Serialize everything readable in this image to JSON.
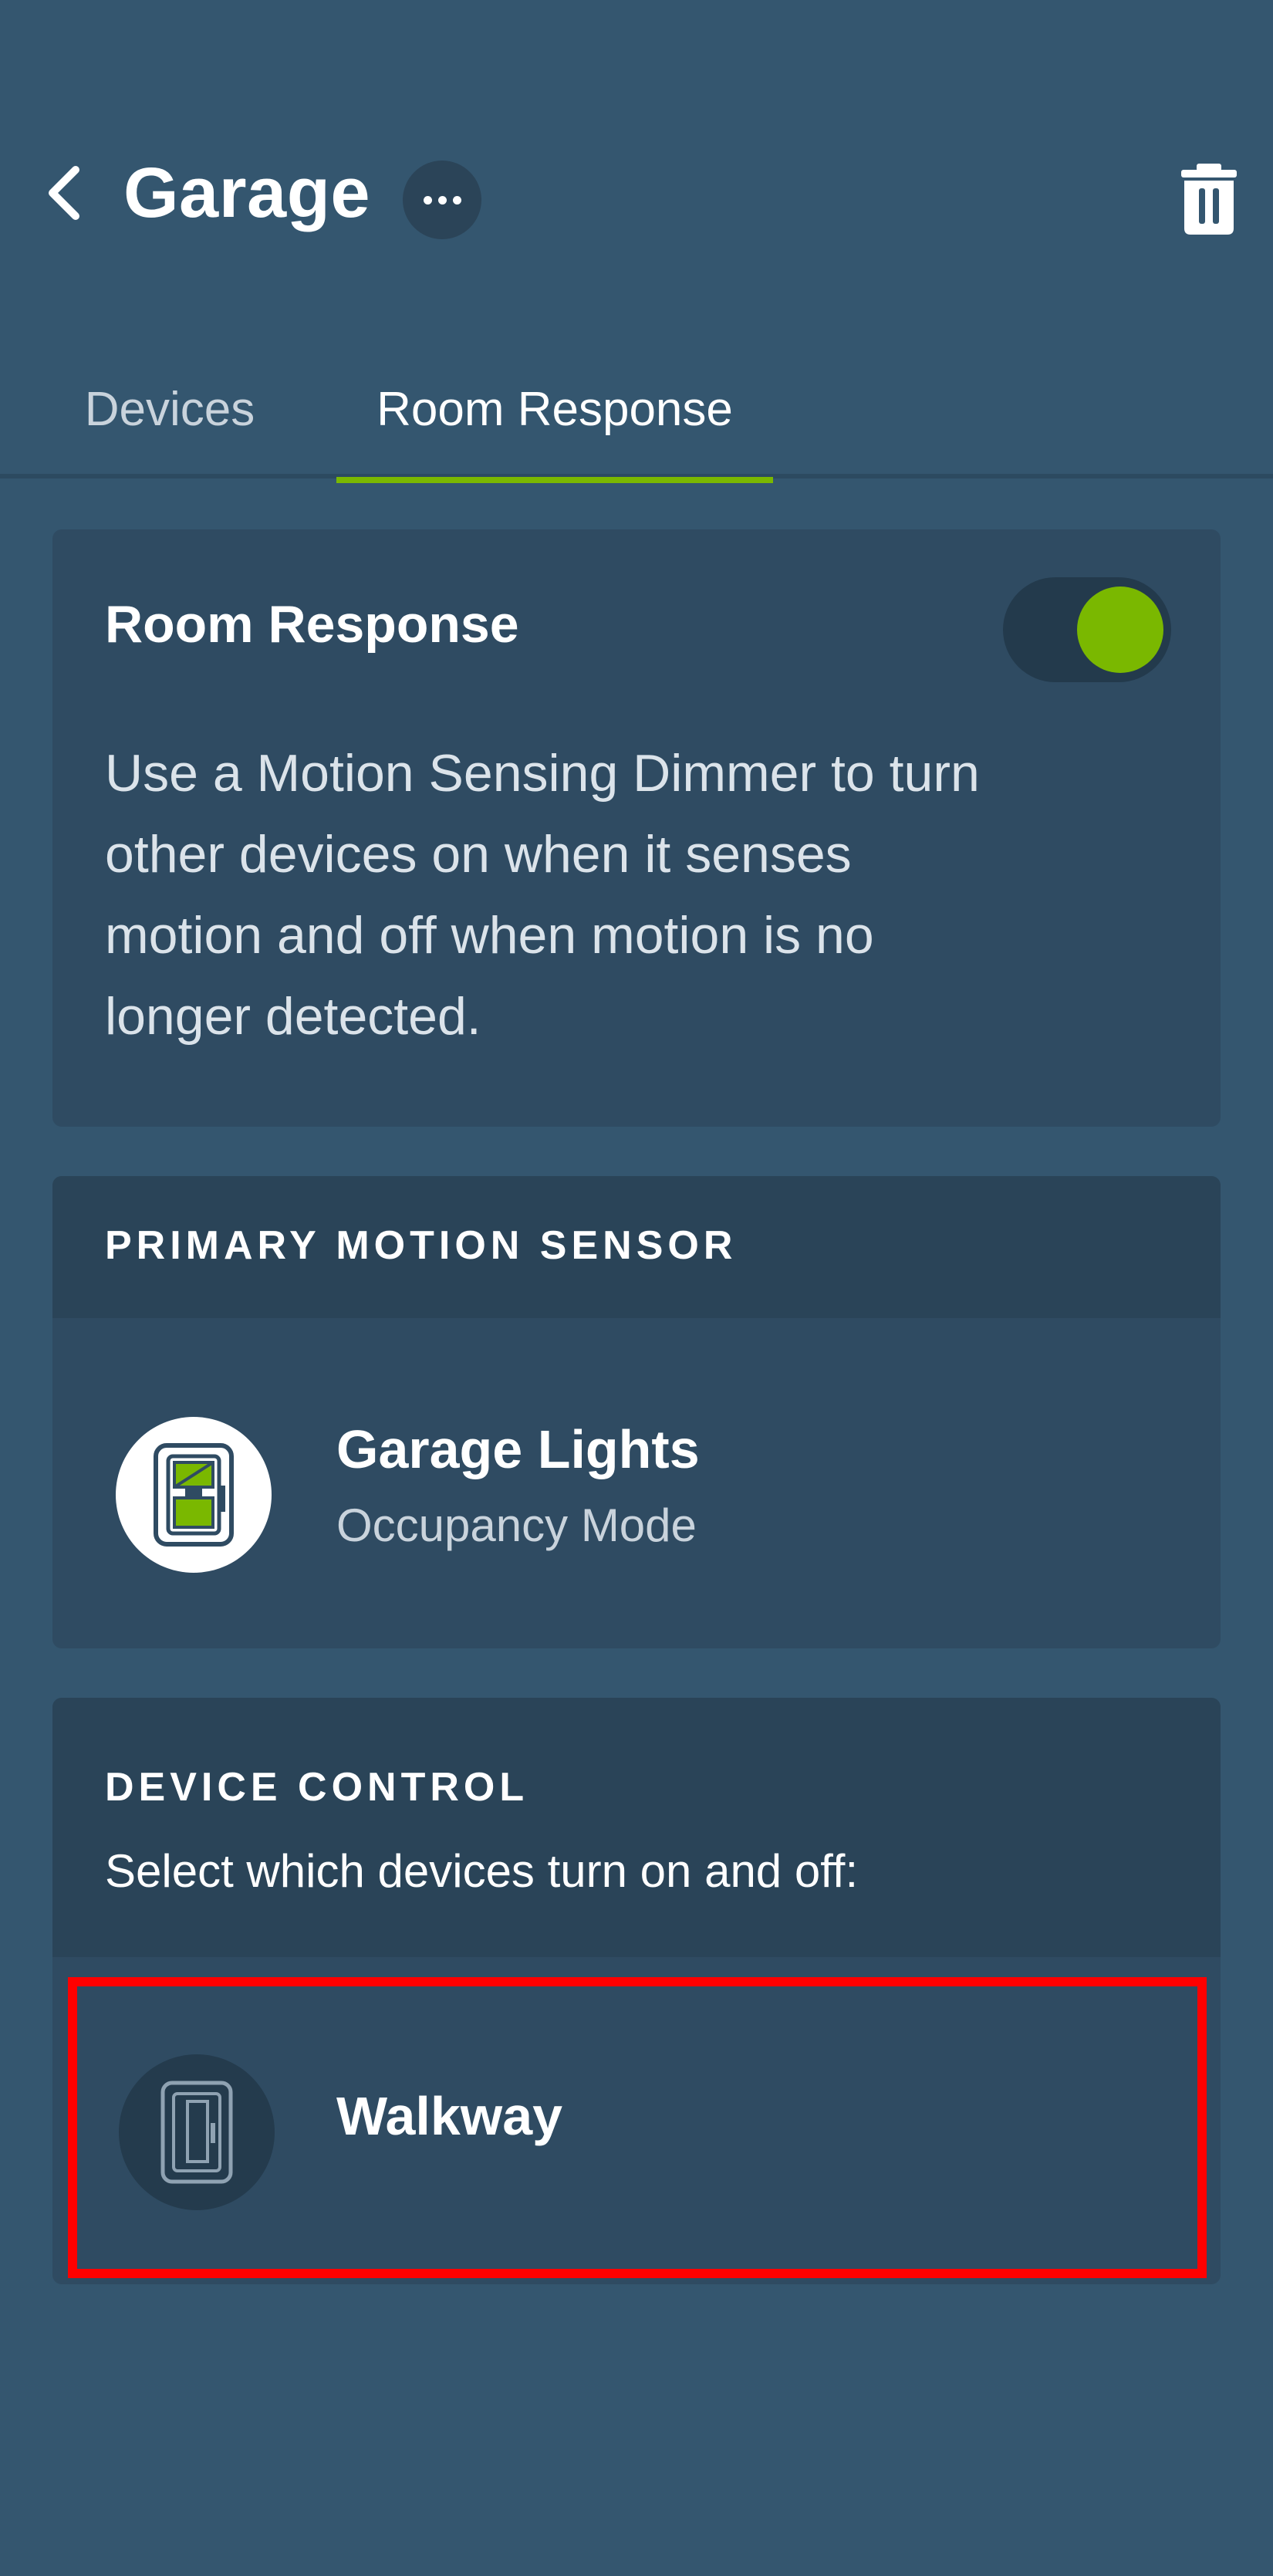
{
  "header": {
    "title": "Garage",
    "back_icon": "chevron-left-icon",
    "more_icon": "ellipsis-icon",
    "delete_icon": "trash-icon"
  },
  "tabs": [
    {
      "label": "Devices",
      "active": false
    },
    {
      "label": "Room Response",
      "active": true
    }
  ],
  "room_response": {
    "title": "Room Response",
    "enabled": true,
    "description": "Use a Motion Sensing Dimmer to turn other devices on when it senses motion and off when motion is no longer detected."
  },
  "primary_sensor": {
    "section_label": "PRIMARY MOTION SENSOR",
    "device": {
      "name": "Garage Lights",
      "mode": "Occupancy Mode",
      "icon": "motion-dimmer-icon"
    }
  },
  "device_control": {
    "section_label": "DEVICE CONTROL",
    "description": "Select which devices turn on and off:",
    "devices": [
      {
        "name": "Walkway",
        "icon": "switch-icon"
      }
    ]
  },
  "colors": {
    "background": "#34566f",
    "card": "#2f4b62",
    "section_header": "#2a4458",
    "accent": "#7ab800",
    "highlight": "#ff0000"
  }
}
